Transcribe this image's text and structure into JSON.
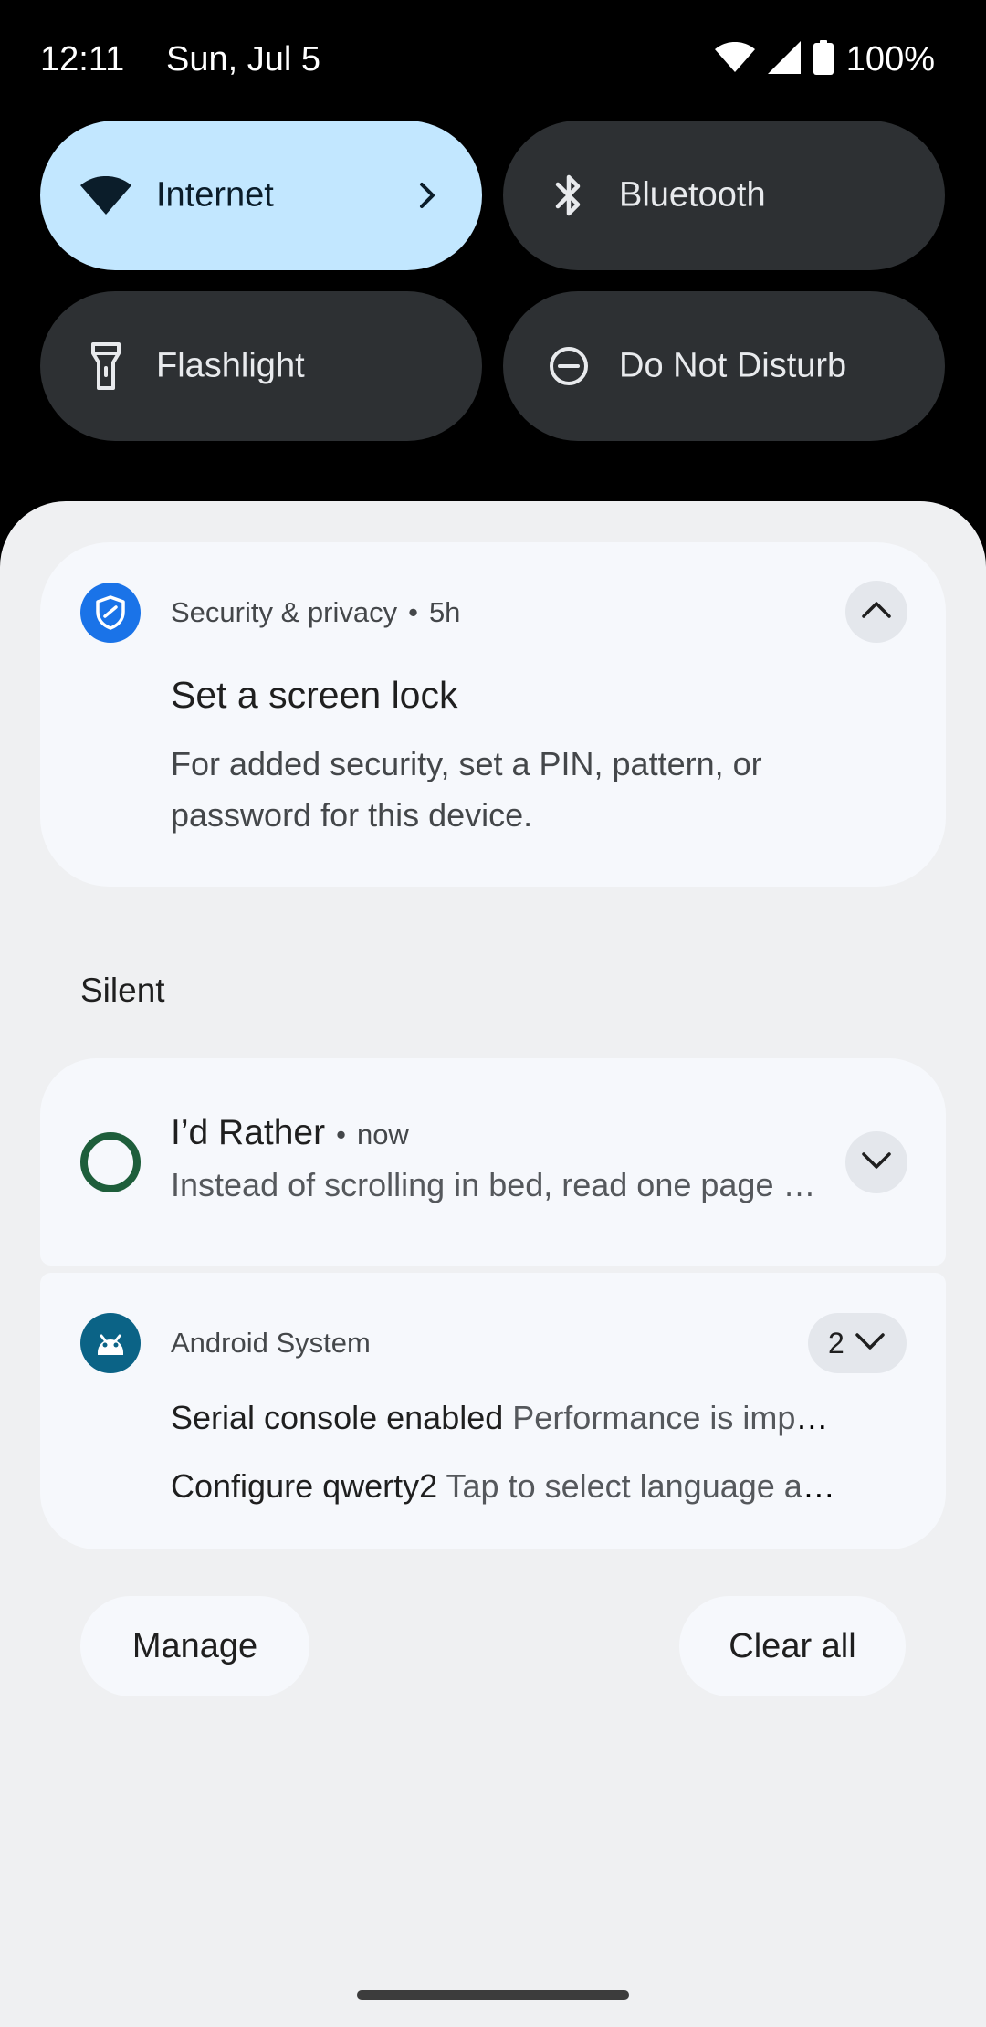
{
  "status_bar": {
    "time": "12:11",
    "date": "Sun, Jul 5",
    "battery": "100%"
  },
  "quick_settings": {
    "internet": "Internet",
    "bluetooth": "Bluetooth",
    "flashlight": "Flashlight",
    "dnd": "Do Not Disturb"
  },
  "notifications": {
    "security": {
      "app": "Security & privacy",
      "time": "5h",
      "title": "Set a screen lock",
      "body": "For added security, set a PIN, pattern, or password for this device."
    },
    "section_label": "Silent",
    "rather": {
      "app": "I’d Rather",
      "time": "now",
      "text": "Instead of scrolling in bed, read one page of a book."
    },
    "android": {
      "app": "Android System",
      "count": "2",
      "items": [
        {
          "title": "Serial console enabled",
          "text": "Performance is impacted. To disable, check bootloader."
        },
        {
          "title": "Configure qwerty2",
          "text": "Tap to select language and layout"
        }
      ]
    }
  },
  "actions": {
    "manage": "Manage",
    "clear_all": "Clear all"
  },
  "colors": {
    "active_tile": "#c2e7ff",
    "inactive_tile": "#2d3033",
    "shade": "#eff0f2",
    "card": "#f6f8fc",
    "security_icon": "#1a73e8",
    "rather_ring": "#1e5e3b",
    "android_icon": "#0b6386"
  },
  "icons": [
    "wifi-icon",
    "signal-icon",
    "battery-icon",
    "chevron-right-icon",
    "bluetooth-icon",
    "flashlight-icon",
    "dnd-icon",
    "shield-icon",
    "chevron-up-icon",
    "chevron-down-icon",
    "android-icon"
  ]
}
